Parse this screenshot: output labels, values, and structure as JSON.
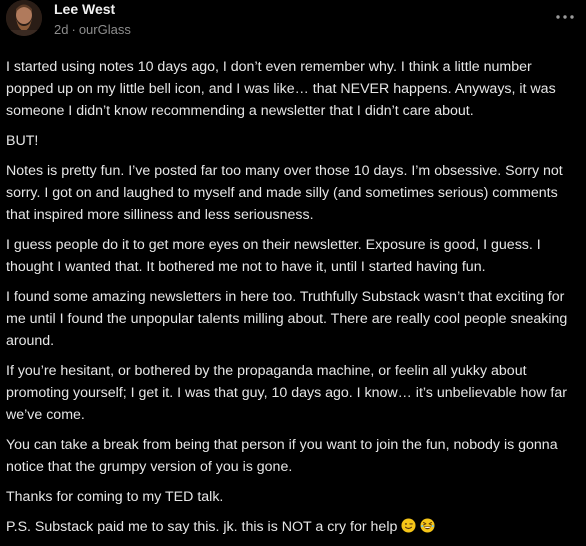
{
  "author": {
    "name": "Lee West"
  },
  "meta": {
    "age": "2d",
    "separator": "·",
    "publication": "ourGlass"
  },
  "icons": {
    "avatar": "avatar-photo",
    "more": "more-horizontal-icon",
    "emoji_1": "winking-face-emoji",
    "emoji_2": "grinning-squinting-face-emoji"
  },
  "post": {
    "paragraphs": [
      "I started using notes 10 days ago, I don’t even remember why. I think a little number popped up on my little bell icon, and I was like… that NEVER happens. Anyways, it was someone I didn’t know recommending a newsletter that I didn’t care about.",
      "BUT!",
      "Notes is pretty fun. I’ve posted far too many over those 10 days. I’m obsessive. Sorry not sorry. I got on and laughed to myself and made silly (and sometimes serious) comments that inspired more silliness and less seriousness.",
      "I guess people do it to get more eyes on their newsletter. Exposure is good, I guess. I thought I wanted that. It bothered me not to have it, until I started having fun.",
      "I found some amazing newsletters in here too. Truthfully Substack wasn’t that exciting for me until I found the unpopular talents milling about. There are really cool people sneaking around.",
      "If you’re hesitant, or bothered by the propaganda machine, or feelin all yukky about promoting yourself; I get it. I was that guy, 10 days ago. I know… it’s unbelievable how far we’ve come.",
      "You can take a break from being that person if you want to join the fun, nobody is gonna notice that the grumpy version of you is gone.",
      "Thanks for coming to my TED talk.",
      "P.S. Substack paid me to say this. jk. this is NOT a cry for help"
    ]
  },
  "colors": {
    "background": "#000000",
    "text": "#e6e6e6",
    "meta": "#8d8d8d",
    "emoji": "#f5c518"
  }
}
